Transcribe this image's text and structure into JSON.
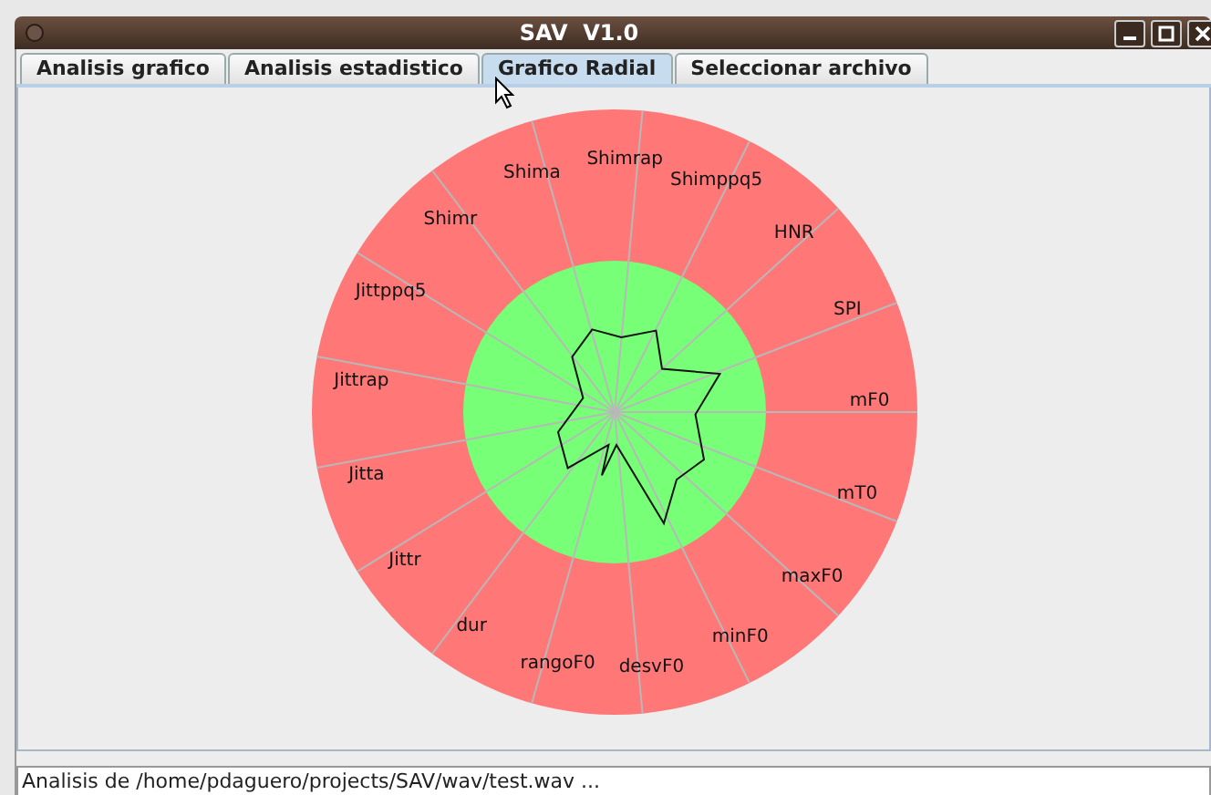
{
  "window": {
    "title": "SAV  V1.0"
  },
  "tabs": [
    {
      "label": "Analisis grafico",
      "selected": false
    },
    {
      "label": "Analisis estadistico",
      "selected": false
    },
    {
      "label": "Grafico Radial",
      "selected": true
    },
    {
      "label": "Seleccionar archivo",
      "selected": false
    }
  ],
  "radar": {
    "axes": [
      "Shimrap",
      "Shima",
      "Shimppq5",
      "Shimr",
      "HNR",
      "Jittppq5",
      "SPI",
      "Jittrap",
      "mF0",
      "Jitta",
      "mT0",
      "Jittr",
      "maxF0",
      "dur",
      "minF0",
      "rangoF0",
      "desvF0"
    ]
  },
  "status_bar": {
    "text": "Analisis de /home/pdaguero/projects/SAV/wav/test.wav ..."
  }
}
